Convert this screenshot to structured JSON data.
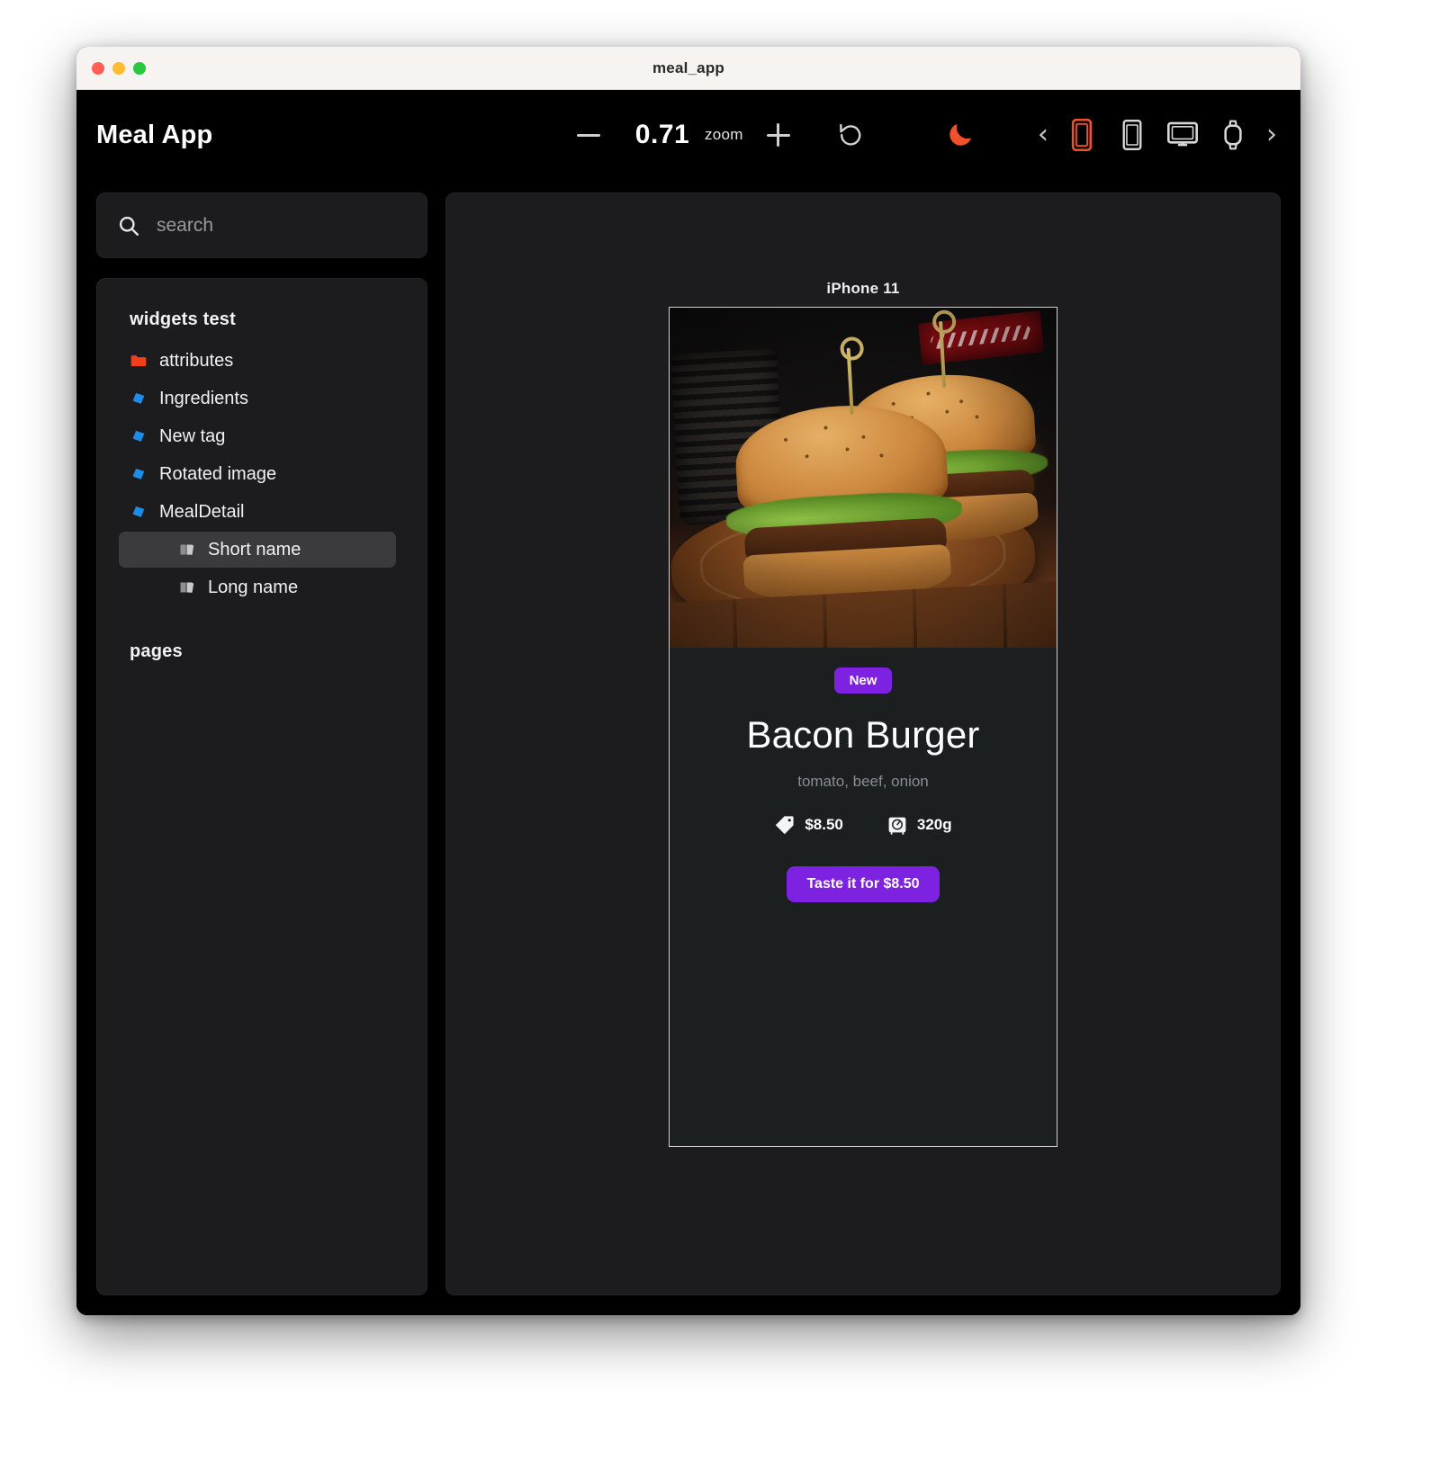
{
  "window": {
    "title": "meal_app",
    "traffic_lights": [
      "close",
      "minimize",
      "maximize"
    ]
  },
  "toolbar": {
    "brand": "Meal App",
    "zoom_out_icon": "minus-icon",
    "zoom_value": "0.71",
    "zoom_label": "zoom",
    "zoom_in_icon": "plus-icon",
    "reset_icon": "rotate-ccw-icon",
    "theme_icon": "moon-icon",
    "theme_color": "#f0502a",
    "prev_icon": "chevron-left-icon",
    "next_icon": "chevron-right-icon",
    "devices": [
      {
        "name": "phone",
        "icon": "phone-icon",
        "selected": true
      },
      {
        "name": "tablet",
        "icon": "tablet-icon",
        "selected": false
      },
      {
        "name": "desktop",
        "icon": "desktop-icon",
        "selected": false
      },
      {
        "name": "watch",
        "icon": "watch-icon",
        "selected": false
      }
    ],
    "accent": "#f0502a"
  },
  "sidebar": {
    "search": {
      "value": "",
      "placeholder": "search",
      "icon": "search-icon"
    },
    "sections": [
      {
        "title": "widgets test",
        "items": [
          {
            "label": "attributes",
            "icon": "folder-icon",
            "depth": 0,
            "selected": false
          },
          {
            "label": "Ingredients",
            "icon": "component-icon",
            "depth": 0,
            "selected": false
          },
          {
            "label": "New tag",
            "icon": "component-icon",
            "depth": 0,
            "selected": false
          },
          {
            "label": "Rotated image",
            "icon": "component-icon",
            "depth": 0,
            "selected": false
          },
          {
            "label": "MealDetail",
            "icon": "component-icon",
            "depth": 0,
            "selected": false
          },
          {
            "label": "Short name",
            "icon": "story-icon",
            "depth": 1,
            "selected": true
          },
          {
            "label": "Long name",
            "icon": "story-icon",
            "depth": 1,
            "selected": false
          }
        ]
      },
      {
        "title": "pages",
        "items": []
      }
    ]
  },
  "preview": {
    "device_label": "iPhone 11",
    "card": {
      "image_alt": "bacon burger photo",
      "badge": "New",
      "title": "Bacon Burger",
      "ingredients": "tomato, beef, onion",
      "price_icon": "price-tag-icon",
      "price": "$8.50",
      "weight_icon": "scale-icon",
      "weight": "320g",
      "cta_label": "Taste it for $8.50",
      "accent": "#7c22e0"
    }
  }
}
